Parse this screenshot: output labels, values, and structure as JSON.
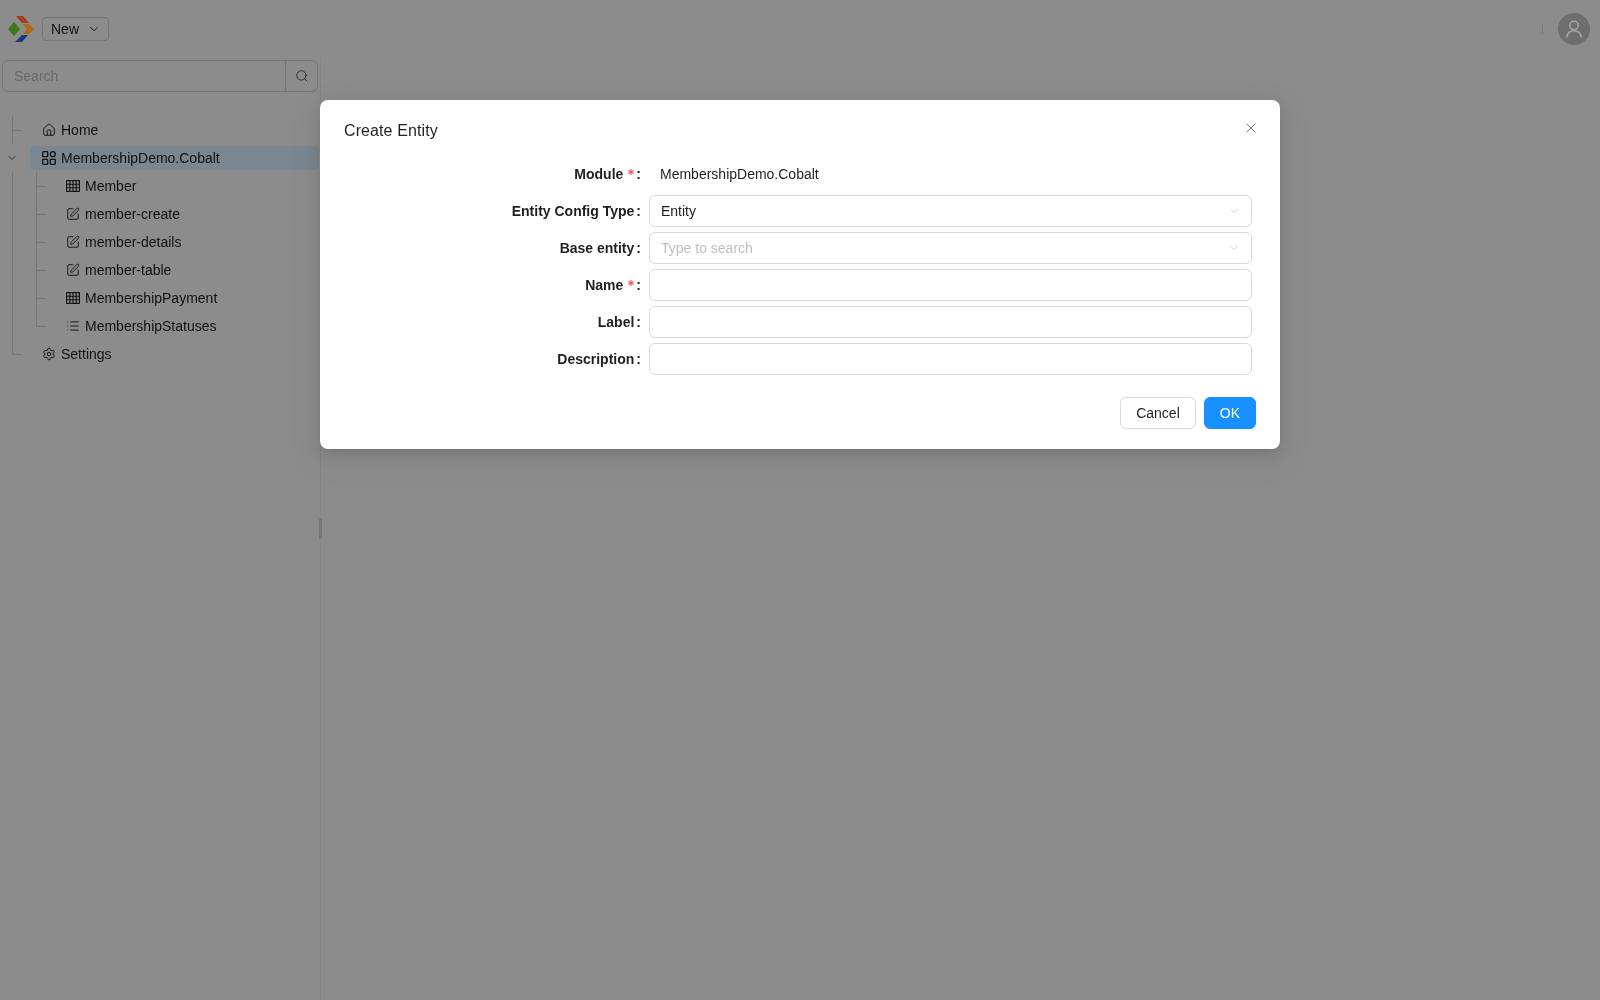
{
  "header": {
    "new_button": {
      "label": "New"
    }
  },
  "sidebar": {
    "search": {
      "placeholder": "Search"
    },
    "tree": [
      {
        "label": "Home",
        "kind": "home",
        "selected": false
      },
      {
        "label": "MembershipDemo.Cobalt",
        "kind": "module",
        "selected": true,
        "expanded": true,
        "children": [
          {
            "label": "Member",
            "kind": "entity",
            "selected": false
          },
          {
            "label": "member-create",
            "kind": "form",
            "selected": false
          },
          {
            "label": "member-details",
            "kind": "form",
            "selected": false
          },
          {
            "label": "member-table",
            "kind": "form",
            "selected": false
          },
          {
            "label": "MembershipPayment",
            "kind": "entity",
            "selected": false
          },
          {
            "label": "MembershipStatuses",
            "kind": "reflist",
            "selected": false
          }
        ]
      },
      {
        "label": "Settings",
        "kind": "settings",
        "selected": false
      }
    ]
  },
  "dialog": {
    "title": "Create Entity",
    "fields": [
      {
        "label": "Module",
        "colon": ":",
        "required": true,
        "kind": "static",
        "value": "MembershipDemo.Cobalt"
      },
      {
        "label": "Entity Config Type",
        "colon": ":",
        "required": false,
        "kind": "select",
        "value": "Entity"
      },
      {
        "label": "Base entity",
        "colon": ":",
        "required": false,
        "kind": "select",
        "placeholder": "Type to search"
      },
      {
        "label": "Name",
        "colon": ":",
        "required": true,
        "kind": "input"
      },
      {
        "label": "Label",
        "colon": ":",
        "required": false,
        "kind": "input"
      },
      {
        "label": "Description",
        "colon": ":",
        "required": false,
        "kind": "input"
      }
    ],
    "buttons": [
      {
        "label": "Cancel",
        "kind": "default"
      },
      {
        "label": "OK",
        "kind": "primary"
      }
    ]
  }
}
